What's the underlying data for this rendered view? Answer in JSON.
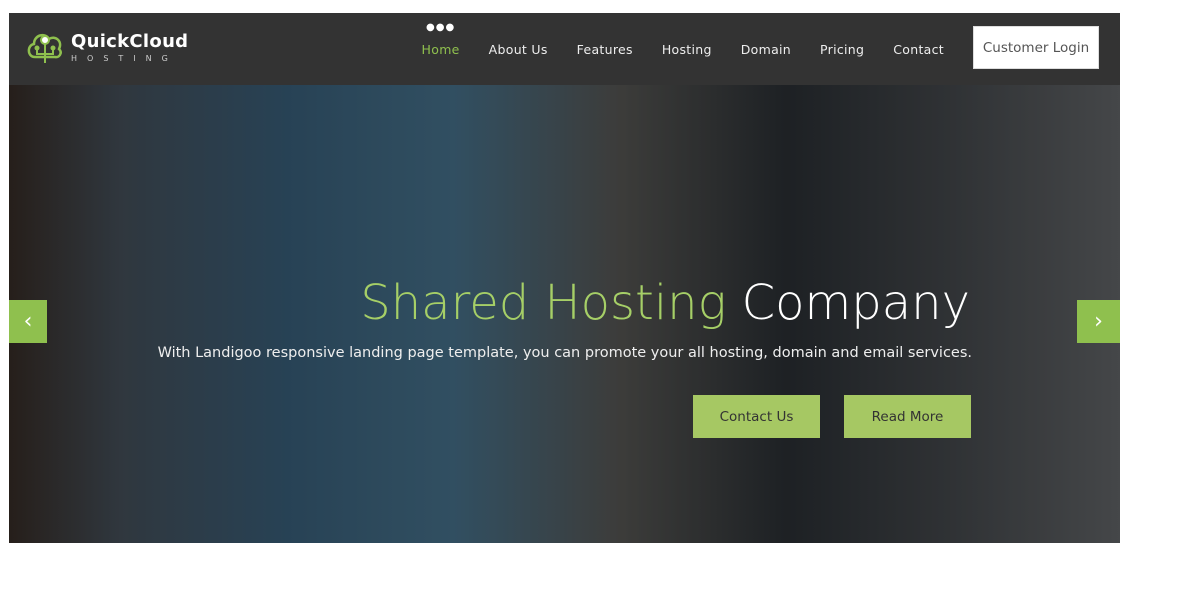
{
  "brand": {
    "name": "QuickCloud",
    "tagline": "HOSTING",
    "accent": "#8fc04e"
  },
  "nav": {
    "items": [
      {
        "label": "Home",
        "active": true
      },
      {
        "label": "About Us"
      },
      {
        "label": "Features"
      },
      {
        "label": "Hosting"
      },
      {
        "label": "Domain"
      },
      {
        "label": "Pricing"
      },
      {
        "label": "Contact"
      }
    ],
    "login": "Customer Login"
  },
  "hero": {
    "title_green": "Shared Hosting",
    "title_white": "Company",
    "subtitle": "With Landigoo responsive landing page template, you can promote your all hosting, domain and email services.",
    "buttons": [
      "Contact Us",
      "Read More"
    ],
    "prev_icon": "chevron-left-icon",
    "next_icon": "chevron-right-icon"
  }
}
